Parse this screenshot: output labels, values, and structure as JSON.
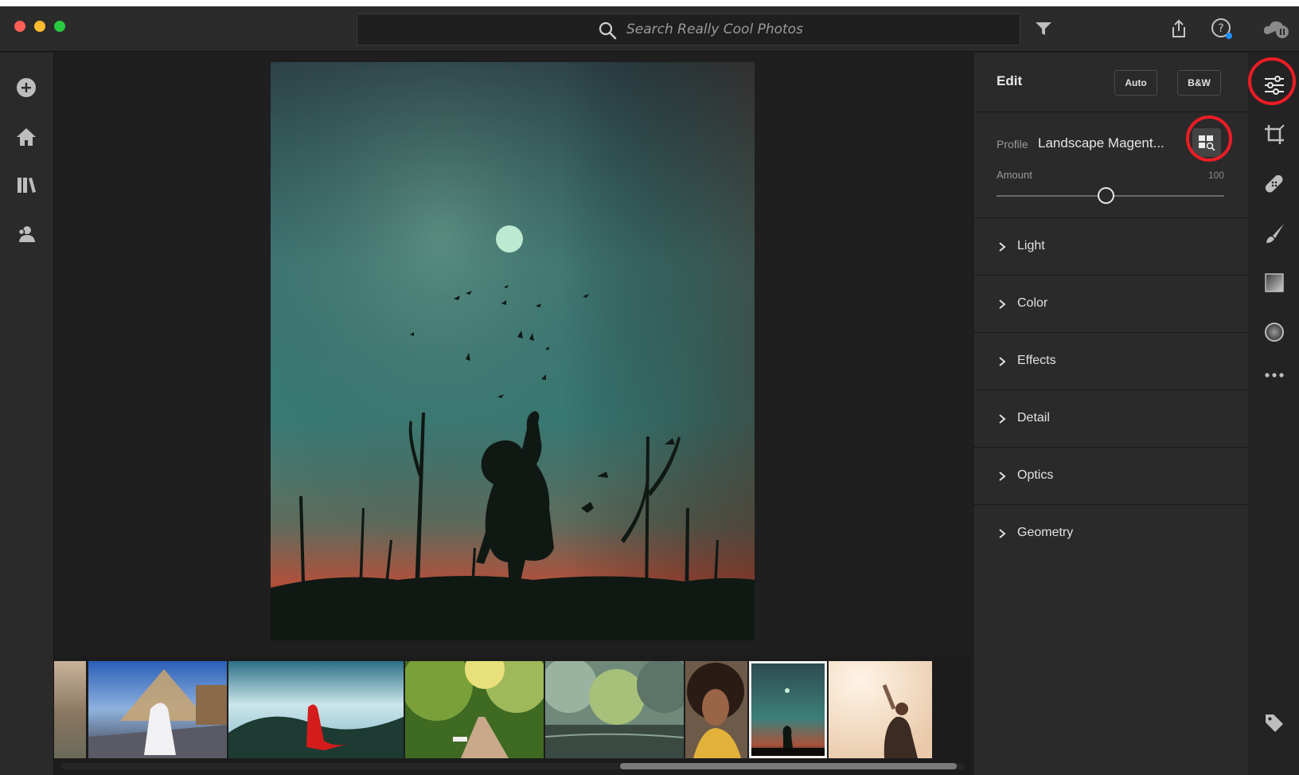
{
  "window": {
    "traffic_lights": {
      "close": "#fe5f57",
      "minimize": "#febc2e",
      "zoom": "#28c840"
    }
  },
  "titlebar": {
    "search": {
      "placeholder": "Search Really Cool Photos",
      "value": ""
    },
    "icons": [
      "search-icon",
      "filter-icon",
      "share-icon",
      "help-icon",
      "cloud-sync-icon"
    ]
  },
  "left_rail": {
    "items": [
      "add-photos-icon",
      "home-icon",
      "library-icon",
      "people-icon"
    ]
  },
  "edit_panel": {
    "title": "Edit",
    "auto_label": "Auto",
    "bw_label": "B&W",
    "profile": {
      "label": "Profile",
      "value": "Landscape Magent..."
    },
    "amount": {
      "label": "Amount",
      "value": "100",
      "level": 0.5
    },
    "sections": [
      {
        "label": "Light"
      },
      {
        "label": "Color"
      },
      {
        "label": "Effects"
      },
      {
        "label": "Detail"
      },
      {
        "label": "Optics"
      },
      {
        "label": "Geometry"
      }
    ]
  },
  "tool_rail": {
    "tools": [
      "edit-sliders-icon",
      "crop-icon",
      "healing-brush-icon",
      "brush-icon",
      "linear-gradient-icon",
      "radial-gradient-icon",
      "more-icon",
      "keyword-tag-icon"
    ],
    "active": "edit-sliders-icon"
  },
  "highlights": {
    "color": "#ee1c25"
  },
  "filmstrip": {
    "selected_index": 6
  }
}
